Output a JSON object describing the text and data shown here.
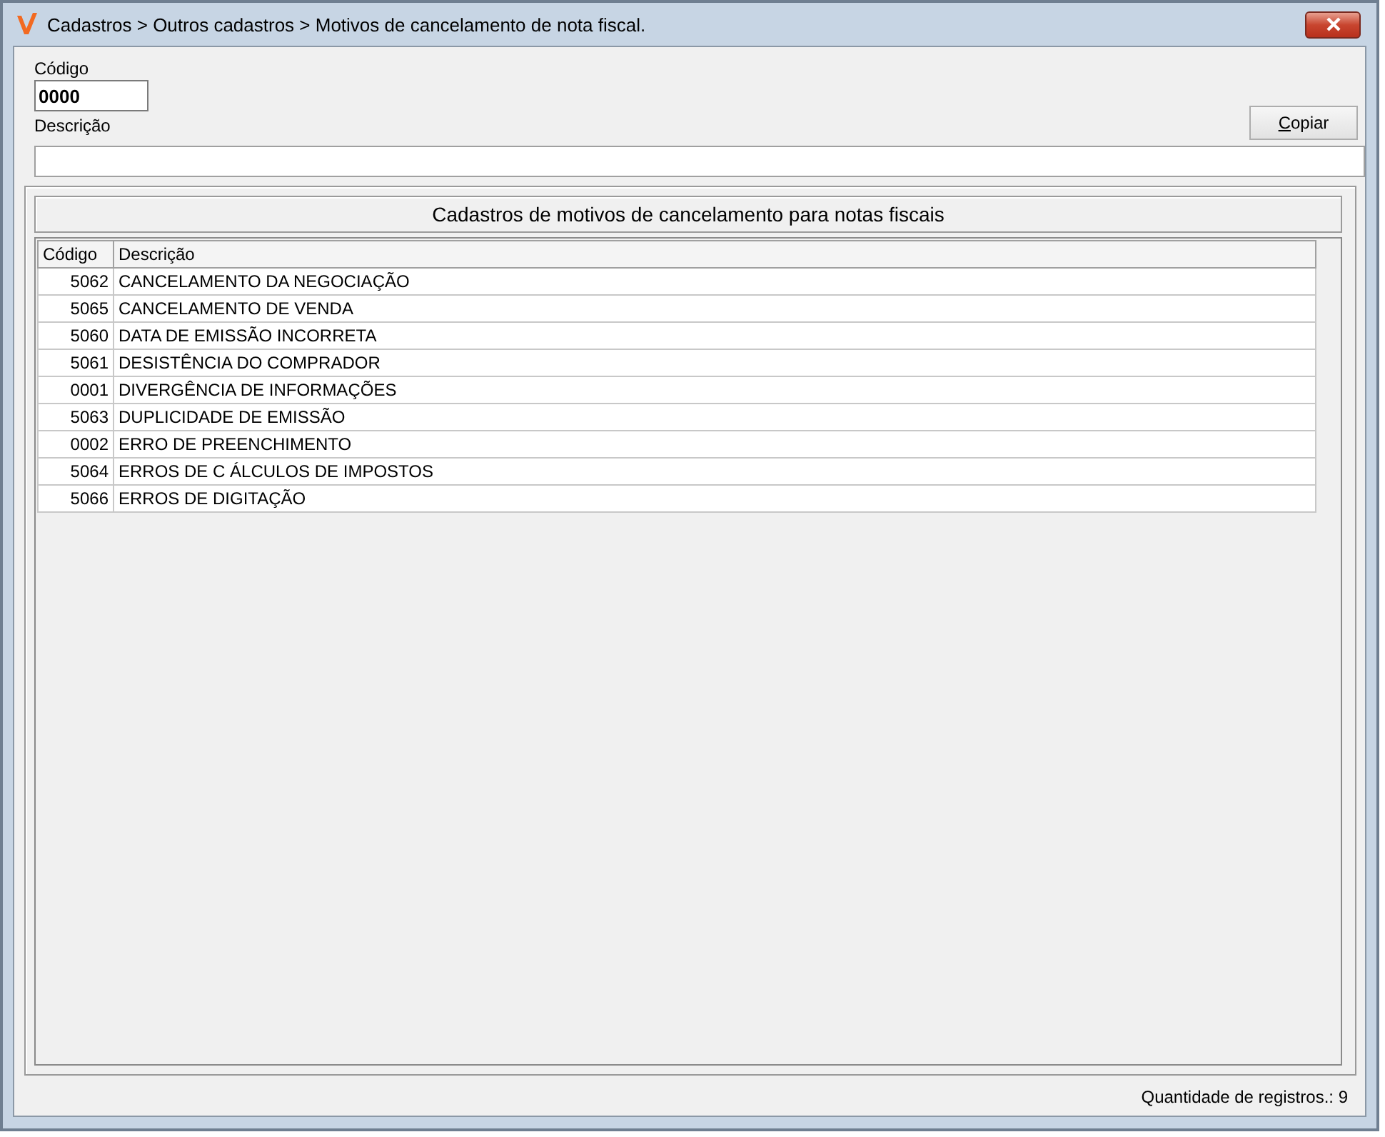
{
  "window": {
    "title": "Cadastros > Outros cadastros > Motivos de cancelamento de nota fiscal."
  },
  "form": {
    "codigo_label": "Código",
    "codigo_value": "0000",
    "descricao_label": "Descrição",
    "copy_button": "Copiar"
  },
  "group": {
    "title": "Cadastros de motivos de cancelamento para notas fiscais"
  },
  "table": {
    "columns": [
      "Código",
      "Descrição"
    ],
    "rows": [
      {
        "code": "5062",
        "description": "CANCELAMENTO DA NEGOCIAÇÃO"
      },
      {
        "code": "5065",
        "description": "CANCELAMENTO DE VENDA"
      },
      {
        "code": "5060",
        "description": "DATA DE EMISSÃO INCORRETA"
      },
      {
        "code": "5061",
        "description": "DESISTÊNCIA DO COMPRADOR"
      },
      {
        "code": "0001",
        "description": "DIVERGÊNCIA DE INFORMAÇÕES"
      },
      {
        "code": "5063",
        "description": "DUPLICIDADE DE EMISSÃO"
      },
      {
        "code": "0002",
        "description": "ERRO DE PREENCHIMENTO"
      },
      {
        "code": "5064",
        "description": "ERROS DE C ÁLCULOS DE IMPOSTOS"
      },
      {
        "code": "5066",
        "description": "ERROS DE DIGITAÇÃO"
      }
    ]
  },
  "status_bar": {
    "text": "Quantidade de registros.: 9"
  }
}
